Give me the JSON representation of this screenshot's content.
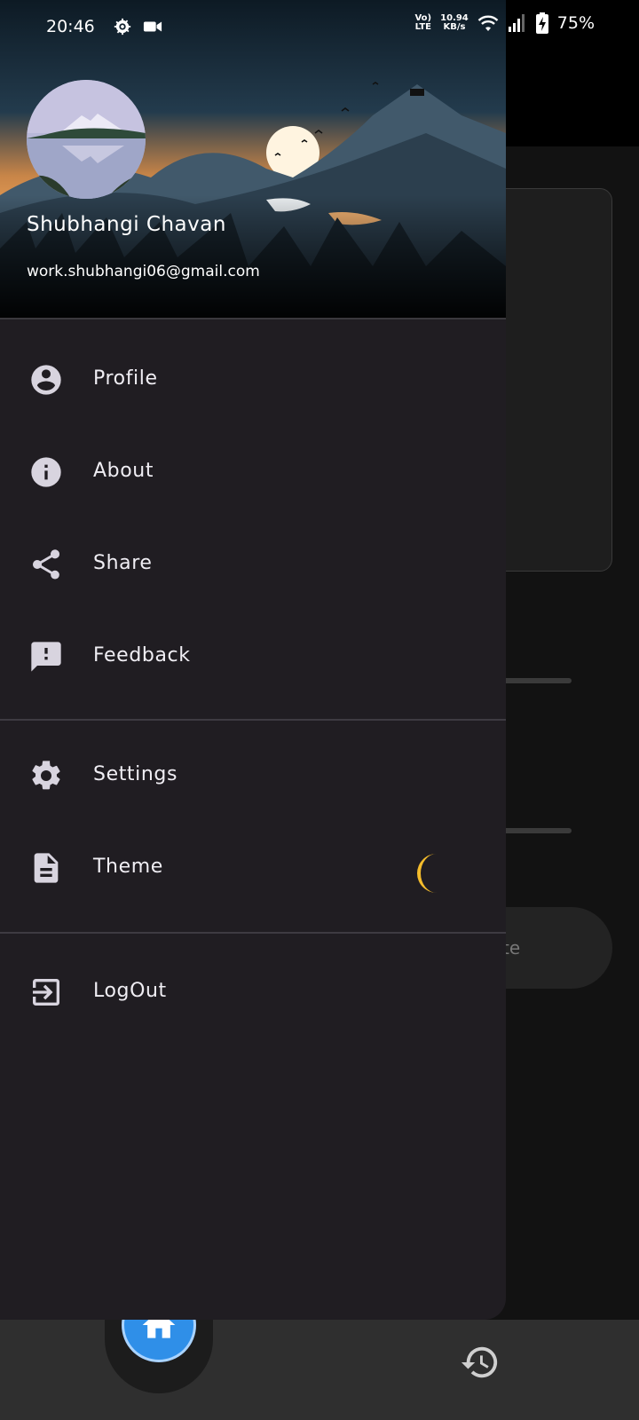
{
  "status_bar": {
    "time": "20:46",
    "volte_top": "Vo)",
    "volte_bottom": "LTE",
    "speed_top": "10.94",
    "speed_bottom": "KB/s",
    "battery": "75%"
  },
  "background": {
    "input_partial_text": "te"
  },
  "drawer": {
    "user_name": "Shubhangi Chavan",
    "user_email": "work.shubhangi06@gmail.com",
    "menu": [
      {
        "label": "Profile",
        "icon": "account-circle-icon"
      },
      {
        "label": "About",
        "icon": "info-icon"
      },
      {
        "label": "Share",
        "icon": "share-icon"
      },
      {
        "label": "Feedback",
        "icon": "feedback-icon"
      },
      {
        "label": "Settings",
        "icon": "gear-icon"
      },
      {
        "label": "Theme",
        "icon": "document-icon"
      },
      {
        "label": "LogOut",
        "icon": "logout-icon"
      }
    ]
  },
  "colors": {
    "drawer_bg": "#201d22",
    "accent_blue": "#2f8fe8",
    "moon_yellow": "#f4bc2c"
  }
}
